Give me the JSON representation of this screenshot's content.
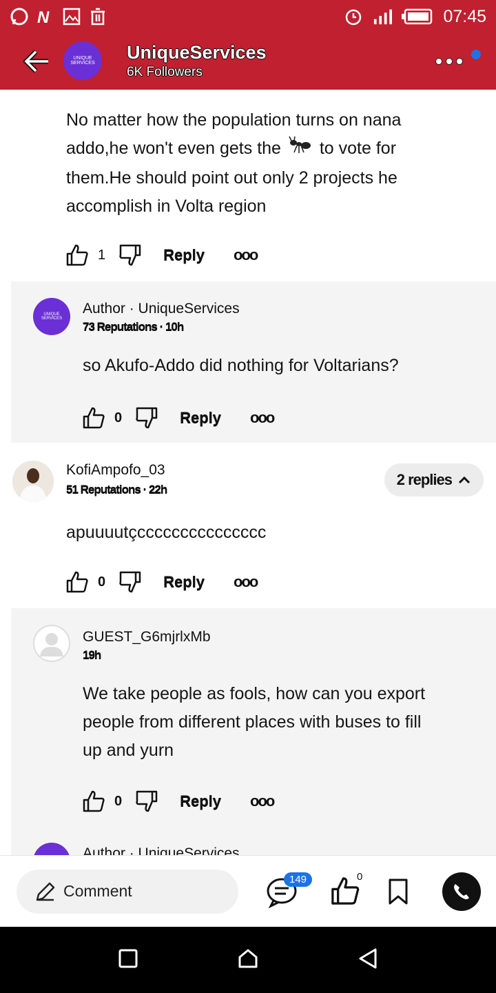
{
  "status_bar": {
    "time": "07:45"
  },
  "header": {
    "channel_name": "UniqueServices",
    "followers": "6K Followers",
    "avatar_text": "UNIQUE SERVICES"
  },
  "comments": [
    {
      "text_line1": "No matter how the population turns on nana",
      "text_line2a": "addo,he won't even gets the",
      "text_line2b": "to vote for",
      "text_line3": "them.He should point out only 2 projects he",
      "text_line4": "accomplish in Volta region",
      "likes": "1",
      "reply_label": "Reply"
    },
    {
      "author_label": "Author · UniqueServices",
      "meta": "73 Reputations · 10h",
      "text": "so Akufo-Addo did nothing for Voltarians?",
      "likes": "0",
      "reply_label": "Reply",
      "avatar_text": "UNIQUE SERVICES"
    },
    {
      "author": "KofiAmpofo_03",
      "meta": "51 Reputations · 22h",
      "text": "apuuuutçccccccccccccccc",
      "likes": "0",
      "reply_label": "Reply",
      "replies_label": "2 replies"
    },
    {
      "author": "GUEST_G6mjrlxMb",
      "meta": "19h",
      "text_line1": "We take people as fools, how can you export",
      "text_line2": "people from different places with buses to fill",
      "text_line3": "up and yurn",
      "likes": "0",
      "reply_label": "Reply"
    },
    {
      "author_label": "Author · UniqueServices"
    }
  ],
  "bottom_bar": {
    "comment_label": "Comment",
    "comment_count": "149",
    "like_count": "0"
  }
}
